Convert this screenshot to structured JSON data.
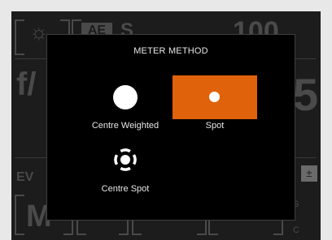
{
  "camera_status": {
    "aperture_prefix": "f/",
    "aperture_value_digit": "5",
    "shutter_value": "100",
    "ae_badge": "AE",
    "ae_mode_letter": "S",
    "mode_letter": "M",
    "ev_label": "EV",
    "side_letter_s": "S",
    "side_letter_c": "C"
  },
  "meter_modal": {
    "title": "METER METHOD",
    "options": [
      {
        "label": "Centre Weighted",
        "icon": "filled-circle-icon",
        "selected": false
      },
      {
        "label": "Spot",
        "icon": "spot-dot-icon",
        "selected": true
      },
      {
        "label": "Centre Spot",
        "icon": "dashed-ring-icon",
        "selected": false
      }
    ]
  },
  "colors": {
    "selected_accent": "#e0620a",
    "modal_bg": "#000000",
    "screen_bg": "#1c1c1c"
  }
}
